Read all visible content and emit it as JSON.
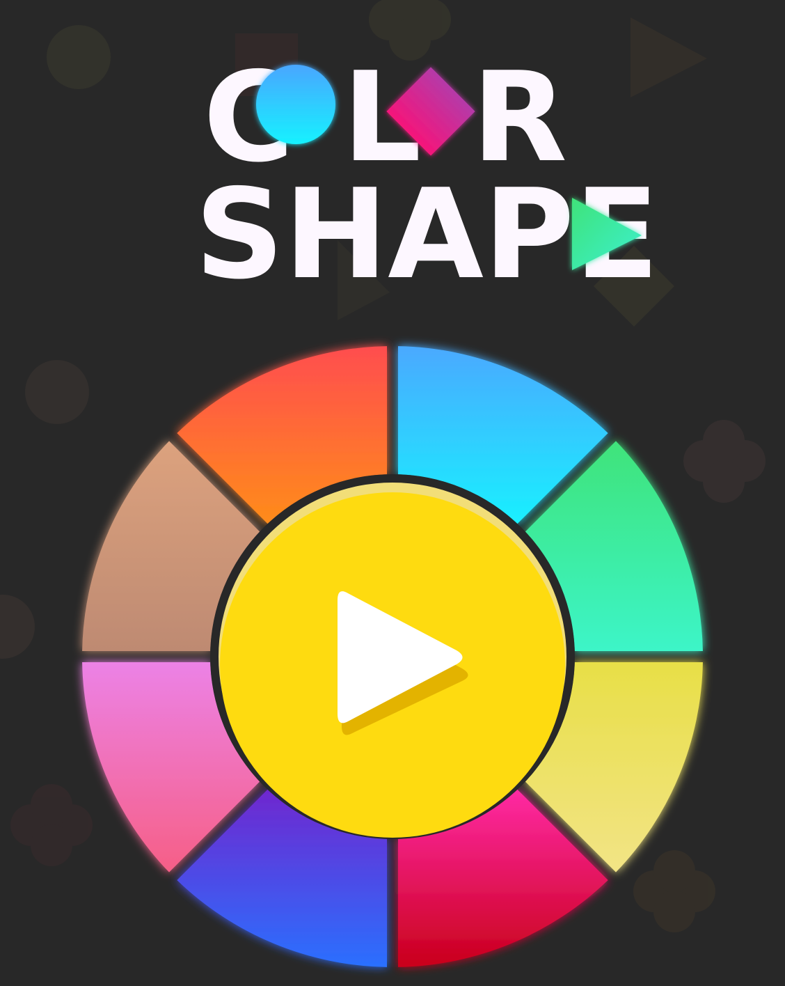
{
  "title": {
    "line1_parts": [
      "C",
      "L",
      "R"
    ],
    "line2": "SHAPE"
  },
  "wheel": {
    "segments": [
      {
        "name": "blue",
        "from": "#4aa9ff",
        "to": "#19f0ff"
      },
      {
        "name": "green",
        "from": "#3fe37a",
        "to": "#3df5c8"
      },
      {
        "name": "yellow",
        "from": "#e8df47",
        "to": "#f2e486"
      },
      {
        "name": "pink",
        "from": "#ff2aa4",
        "to": "#c9001a"
      },
      {
        "name": "indigo",
        "from": "#6f27cf",
        "to": "#2a70ff"
      },
      {
        "name": "rose",
        "from": "#ec82e6",
        "to": "#f65f86"
      },
      {
        "name": "tan",
        "from": "#dca27e",
        "to": "#be8a72"
      },
      {
        "name": "orange",
        "from": "#ff4d4f",
        "to": "#ff8c1a"
      }
    ]
  },
  "play_button": {
    "icon": "play-icon",
    "color": "#fedb10"
  },
  "colors": {
    "background": "#282828",
    "circle_logo": "#2ad2ff",
    "diamond_logo": "#e02b86",
    "triangle_logo": "#3fe8a5"
  }
}
